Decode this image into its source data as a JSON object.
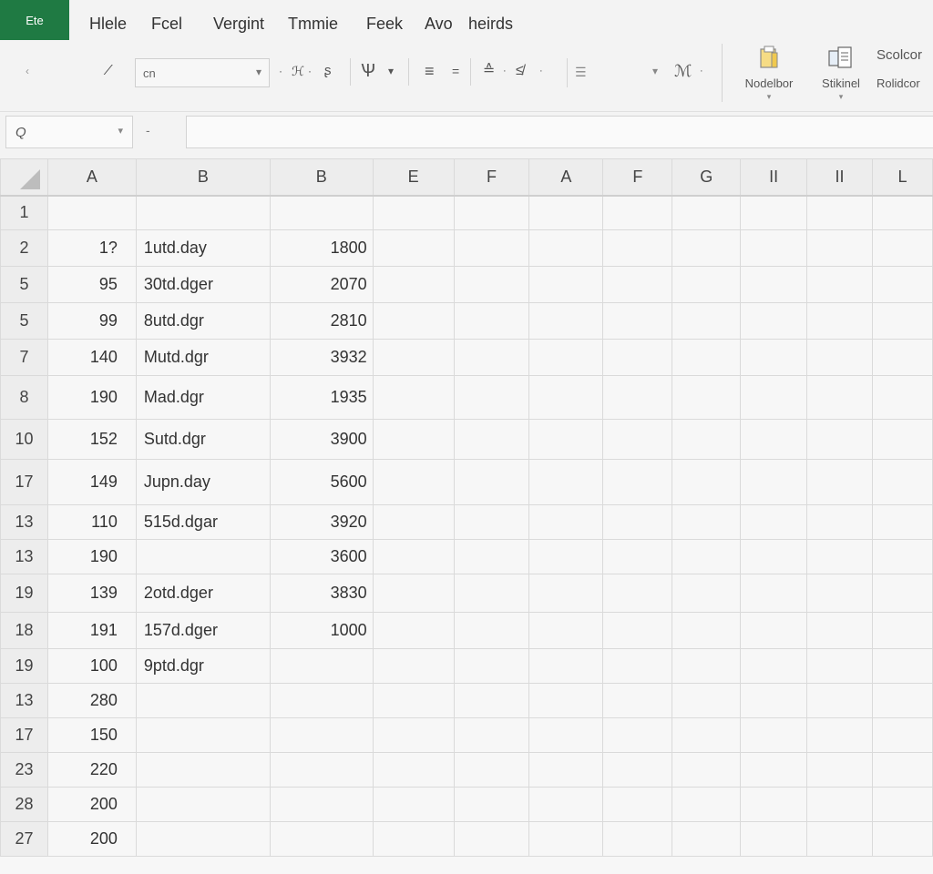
{
  "menubar": {
    "file_tab": "Ete",
    "items": [
      "Hlele",
      "Fcel",
      "Vergint",
      "Tmmie",
      "Feek",
      "Avo",
      "heirds"
    ]
  },
  "ribbon": {
    "font_name": "cn",
    "big_buttons": [
      {
        "label": "Nodelbor",
        "icon": "folder-icon"
      },
      {
        "label": "Stikinel",
        "icon": "clipboard-icon"
      },
      {
        "label": "Rolidcor",
        "icon": "text-icon",
        "glyph": "Scolcor"
      }
    ]
  },
  "formula_bar": {
    "name_box": "Q",
    "value": ""
  },
  "sheet": {
    "columns": [
      "A",
      "B",
      "B",
      "E",
      "F",
      "A",
      "F",
      "G",
      "II",
      "II",
      "L"
    ],
    "rows": [
      {
        "row": "1",
        "a": "",
        "b": "",
        "c": ""
      },
      {
        "row": "2",
        "a": "1?",
        "b": "1utd.day",
        "c": "1800"
      },
      {
        "row": "5",
        "a": "95",
        "b": "30td.dger",
        "c": "2070"
      },
      {
        "row": "5",
        "a": "99",
        "b": "8utd.dgr",
        "c": "2810"
      },
      {
        "row": "7",
        "a": "140",
        "b": "Mutd.dgr",
        "c": "3932"
      },
      {
        "row": "8",
        "a": "190",
        "b": "Mad.dgr",
        "c": "1935"
      },
      {
        "row": "10",
        "a": "152",
        "b": "Sutd.dgr",
        "c": "3900"
      },
      {
        "row": "17",
        "a": "149",
        "b": "Jupn.day",
        "c": "5600"
      },
      {
        "row": "13",
        "a": "110",
        "b": "515d.dgar",
        "c": "3920"
      },
      {
        "row": "13",
        "a": "190",
        "b": "",
        "c": "3600"
      },
      {
        "row": "19",
        "a": "139",
        "b": "2otd.dger",
        "c": "3830"
      },
      {
        "row": "18",
        "a": "191",
        "b": "157d.dger",
        "c": "1000"
      },
      {
        "row": "19",
        "a": "100",
        "b": "9ptd.dgr",
        "c": ""
      },
      {
        "row": "13",
        "a": "280",
        "b": "",
        "c": ""
      },
      {
        "row": "17",
        "a": "150",
        "b": "",
        "c": ""
      },
      {
        "row": "23",
        "a": "220",
        "b": "",
        "c": ""
      },
      {
        "row": "28",
        "a": "200",
        "b": "",
        "c": ""
      },
      {
        "row": "27",
        "a": "200",
        "b": "",
        "c": ""
      }
    ]
  }
}
